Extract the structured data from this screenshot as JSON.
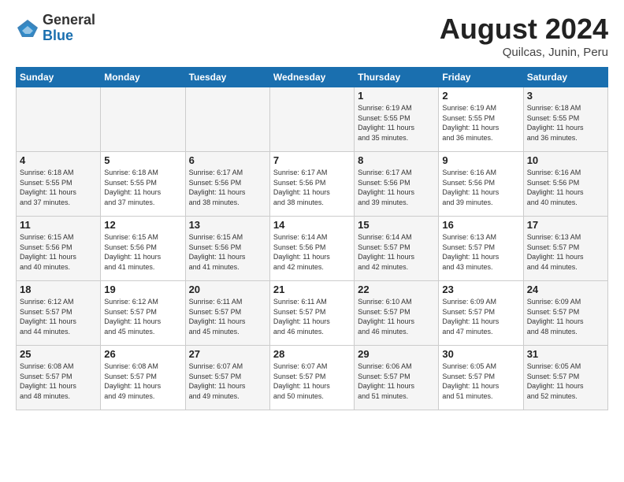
{
  "header": {
    "logo_general": "General",
    "logo_blue": "Blue",
    "month_title": "August 2024",
    "subtitle": "Quilcas, Junin, Peru"
  },
  "weekdays": [
    "Sunday",
    "Monday",
    "Tuesday",
    "Wednesday",
    "Thursday",
    "Friday",
    "Saturday"
  ],
  "weeks": [
    [
      {
        "day": "",
        "info": ""
      },
      {
        "day": "",
        "info": ""
      },
      {
        "day": "",
        "info": ""
      },
      {
        "day": "",
        "info": ""
      },
      {
        "day": "1",
        "info": "Sunrise: 6:19 AM\nSunset: 5:55 PM\nDaylight: 11 hours\nand 35 minutes."
      },
      {
        "day": "2",
        "info": "Sunrise: 6:19 AM\nSunset: 5:55 PM\nDaylight: 11 hours\nand 36 minutes."
      },
      {
        "day": "3",
        "info": "Sunrise: 6:18 AM\nSunset: 5:55 PM\nDaylight: 11 hours\nand 36 minutes."
      }
    ],
    [
      {
        "day": "4",
        "info": "Sunrise: 6:18 AM\nSunset: 5:55 PM\nDaylight: 11 hours\nand 37 minutes."
      },
      {
        "day": "5",
        "info": "Sunrise: 6:18 AM\nSunset: 5:55 PM\nDaylight: 11 hours\nand 37 minutes."
      },
      {
        "day": "6",
        "info": "Sunrise: 6:17 AM\nSunset: 5:56 PM\nDaylight: 11 hours\nand 38 minutes."
      },
      {
        "day": "7",
        "info": "Sunrise: 6:17 AM\nSunset: 5:56 PM\nDaylight: 11 hours\nand 38 minutes."
      },
      {
        "day": "8",
        "info": "Sunrise: 6:17 AM\nSunset: 5:56 PM\nDaylight: 11 hours\nand 39 minutes."
      },
      {
        "day": "9",
        "info": "Sunrise: 6:16 AM\nSunset: 5:56 PM\nDaylight: 11 hours\nand 39 minutes."
      },
      {
        "day": "10",
        "info": "Sunrise: 6:16 AM\nSunset: 5:56 PM\nDaylight: 11 hours\nand 40 minutes."
      }
    ],
    [
      {
        "day": "11",
        "info": "Sunrise: 6:15 AM\nSunset: 5:56 PM\nDaylight: 11 hours\nand 40 minutes."
      },
      {
        "day": "12",
        "info": "Sunrise: 6:15 AM\nSunset: 5:56 PM\nDaylight: 11 hours\nand 41 minutes."
      },
      {
        "day": "13",
        "info": "Sunrise: 6:15 AM\nSunset: 5:56 PM\nDaylight: 11 hours\nand 41 minutes."
      },
      {
        "day": "14",
        "info": "Sunrise: 6:14 AM\nSunset: 5:56 PM\nDaylight: 11 hours\nand 42 minutes."
      },
      {
        "day": "15",
        "info": "Sunrise: 6:14 AM\nSunset: 5:57 PM\nDaylight: 11 hours\nand 42 minutes."
      },
      {
        "day": "16",
        "info": "Sunrise: 6:13 AM\nSunset: 5:57 PM\nDaylight: 11 hours\nand 43 minutes."
      },
      {
        "day": "17",
        "info": "Sunrise: 6:13 AM\nSunset: 5:57 PM\nDaylight: 11 hours\nand 44 minutes."
      }
    ],
    [
      {
        "day": "18",
        "info": "Sunrise: 6:12 AM\nSunset: 5:57 PM\nDaylight: 11 hours\nand 44 minutes."
      },
      {
        "day": "19",
        "info": "Sunrise: 6:12 AM\nSunset: 5:57 PM\nDaylight: 11 hours\nand 45 minutes."
      },
      {
        "day": "20",
        "info": "Sunrise: 6:11 AM\nSunset: 5:57 PM\nDaylight: 11 hours\nand 45 minutes."
      },
      {
        "day": "21",
        "info": "Sunrise: 6:11 AM\nSunset: 5:57 PM\nDaylight: 11 hours\nand 46 minutes."
      },
      {
        "day": "22",
        "info": "Sunrise: 6:10 AM\nSunset: 5:57 PM\nDaylight: 11 hours\nand 46 minutes."
      },
      {
        "day": "23",
        "info": "Sunrise: 6:09 AM\nSunset: 5:57 PM\nDaylight: 11 hours\nand 47 minutes."
      },
      {
        "day": "24",
        "info": "Sunrise: 6:09 AM\nSunset: 5:57 PM\nDaylight: 11 hours\nand 48 minutes."
      }
    ],
    [
      {
        "day": "25",
        "info": "Sunrise: 6:08 AM\nSunset: 5:57 PM\nDaylight: 11 hours\nand 48 minutes."
      },
      {
        "day": "26",
        "info": "Sunrise: 6:08 AM\nSunset: 5:57 PM\nDaylight: 11 hours\nand 49 minutes."
      },
      {
        "day": "27",
        "info": "Sunrise: 6:07 AM\nSunset: 5:57 PM\nDaylight: 11 hours\nand 49 minutes."
      },
      {
        "day": "28",
        "info": "Sunrise: 6:07 AM\nSunset: 5:57 PM\nDaylight: 11 hours\nand 50 minutes."
      },
      {
        "day": "29",
        "info": "Sunrise: 6:06 AM\nSunset: 5:57 PM\nDaylight: 11 hours\nand 51 minutes."
      },
      {
        "day": "30",
        "info": "Sunrise: 6:05 AM\nSunset: 5:57 PM\nDaylight: 11 hours\nand 51 minutes."
      },
      {
        "day": "31",
        "info": "Sunrise: 6:05 AM\nSunset: 5:57 PM\nDaylight: 11 hours\nand 52 minutes."
      }
    ]
  ]
}
